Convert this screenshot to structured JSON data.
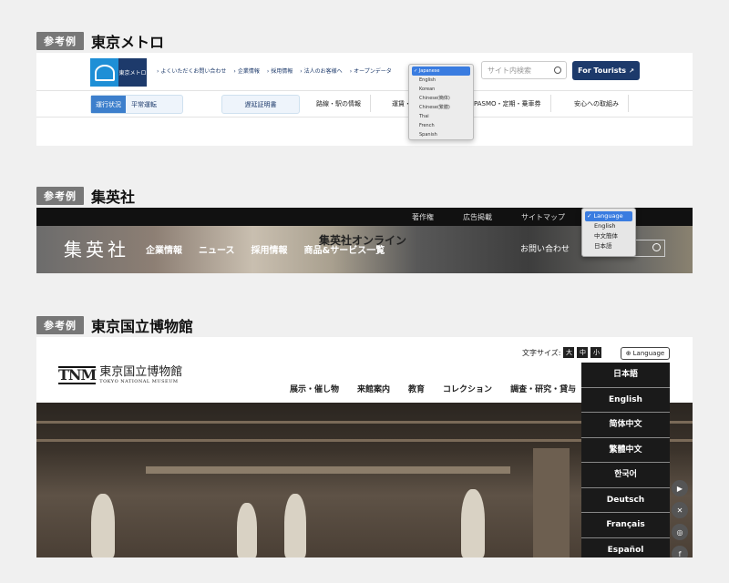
{
  "sections": [
    {
      "tag": "参考例",
      "title": "東京メトロ"
    },
    {
      "tag": "参考例",
      "title": "集英社"
    },
    {
      "tag": "参考例",
      "title": "東京国立博物館"
    }
  ],
  "metro": {
    "logo_text": "東京メトロ",
    "top_links": [
      "よくいただくお問い合わせ",
      "企業情報",
      "採用情報",
      "法人のお客様へ",
      "オープンデータ"
    ],
    "search_placeholder": "サイト内検索",
    "tourists_label": "For Tourists",
    "status_label": "運行状況",
    "status_value": "平常運転",
    "cert_label": "遅延証明書",
    "nav": [
      "路線・駅の情報",
      "運賃・",
      "PASMO・定期・乗車券",
      "安心への取組み"
    ],
    "language_options": [
      "Japanese",
      "English",
      "Korean",
      "Chinese(簡体)",
      "Chinese(繁體)",
      "Thai",
      "French",
      "Spanish"
    ],
    "selected_language": "Japanese",
    "colors": {
      "navy": "#1d3a6b",
      "blue": "#1e8fd6"
    }
  },
  "shueisha": {
    "top_links": [
      "著作権",
      "広告掲載",
      "サイトマップ"
    ],
    "brand": "集英社",
    "menu": [
      "企業情報",
      "ニュース",
      "採用情報",
      "商品&サービス一覧"
    ],
    "online_text": "集英社オンライン",
    "contact": "お問い合わせ",
    "language_options": [
      "Language",
      "English",
      "中文簡体",
      "日本語"
    ],
    "selected_language": "Language"
  },
  "tnm": {
    "logo_mark": "TNM",
    "logo_name": "東京国立博物館",
    "logo_en": "TOKYO NATIONAL MUSEUM",
    "font_size_label": "文字サイズ:",
    "font_sizes": [
      "大",
      "中",
      "小"
    ],
    "language_button": "Language",
    "nav": [
      "展示・催し物",
      "来館案内",
      "教育",
      "コレクション",
      "調査・研究・貸与"
    ],
    "languages": [
      "日本語",
      "English",
      "简体中文",
      "繁體中文",
      "한국어",
      "Deutsch",
      "Français",
      "Español"
    ],
    "social_icons": [
      "youtube-icon",
      "x-icon",
      "instagram-icon",
      "facebook-icon"
    ]
  }
}
